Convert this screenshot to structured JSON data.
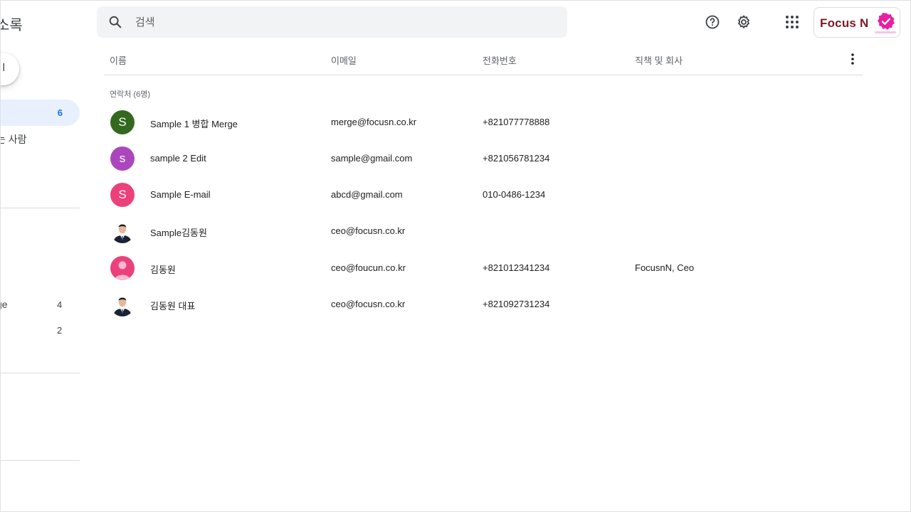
{
  "sidebar": {
    "title": "소록",
    "create_label": "l",
    "active_count": "6",
    "item_frequent": "는 사람",
    "label1_name": "ge",
    "label1_count": "4",
    "label2_count": "2"
  },
  "search": {
    "placeholder": "검색"
  },
  "brand": {
    "name": "Focus N"
  },
  "table": {
    "headers": {
      "name": "이름",
      "email": "이메일",
      "phone": "전화번호",
      "job": "직책 및 회사"
    },
    "section_label": "연락처 (6명)",
    "rows": [
      {
        "avatar": "S",
        "avatar_color": "#33691e",
        "name": "Sample 1 병합 Merge",
        "email": "merge@focusn.co.kr",
        "phone": "+821077778888",
        "job": ""
      },
      {
        "avatar": "s",
        "avatar_color": "#ab47bc",
        "name": "sample 2 Edit",
        "email": "sample@gmail.com",
        "phone": "+821056781234",
        "job": ""
      },
      {
        "avatar": "S",
        "avatar_color": "#ec407a",
        "name": "Sample E-mail",
        "email": "abcd@gmail.com",
        "phone": "010-0486-1234",
        "job": ""
      },
      {
        "avatar": "photo",
        "avatar_color": "",
        "name": "Sample김동원",
        "email": "ceo@focusn.co.kr",
        "phone": "",
        "job": ""
      },
      {
        "avatar": "person",
        "avatar_color": "#ec407a",
        "name": "김동원",
        "email": "ceo@foucun.co.kr",
        "phone": "+821012341234",
        "job": "FocusnN, Ceo"
      },
      {
        "avatar": "photo",
        "avatar_color": "",
        "name": "김동원 대표",
        "email": "ceo@focusn.co.kr",
        "phone": "+821092731234",
        "job": ""
      }
    ]
  },
  "icons": {
    "search": "search-icon",
    "help": "help-icon",
    "settings": "gear-icon",
    "apps": "apps-grid-icon",
    "more": "more-vert-icon"
  }
}
